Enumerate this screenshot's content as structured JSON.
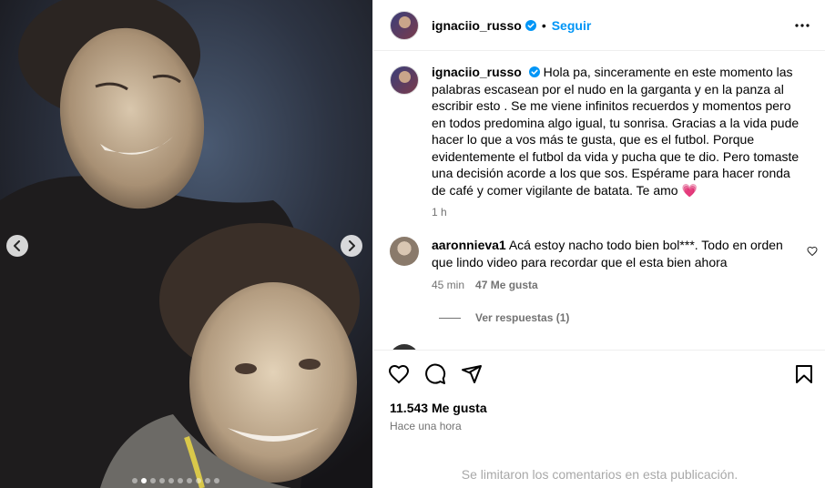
{
  "post": {
    "username": "ignaciio_russo",
    "separator": "•",
    "follow_label": "Seguir"
  },
  "caption": {
    "username": "ignaciio_russo",
    "text": "Hola pa, sinceramente en este momento las palabras escasean por el nudo en la garganta y en la panza al escribir esto . Se me viene infinitos recuerdos y momentos pero en todos predomina algo igual, tu sonrisa. Gracias a la vida pude hacer lo que a vos más te gusta, que es el futbol. Porque evidentemente el futbol da vida y pucha que te dio. Pero tomaste una decisión acorde a los que sos. Espérame para hacer ronda de café y comer vigilante de batata. Te amo",
    "emoji": "💗",
    "time": "1 h"
  },
  "comment": {
    "username": "aaronnieva1",
    "text": "Acá estoy nacho todo bien bol***. Todo en orden que lindo video para recordar que el esta bien ahora",
    "time": "45 min",
    "likes": "47 Me gusta"
  },
  "replies": {
    "label": "Ver respuestas (1)"
  },
  "engagement": {
    "likes": "11.543 Me gusta",
    "time": "Hace una hora",
    "comments_limited": "Se limitaron los comentarios en esta publicación."
  },
  "carousel": {
    "count": 10,
    "active_index": 1
  },
  "colors": {
    "link_blue": "#0095f6",
    "verified_blue": "#0095f6",
    "muted_text": "#737373",
    "divider": "#efefef"
  },
  "icons": {
    "more": "more-options-icon",
    "like": "heart-icon",
    "comment": "comment-icon",
    "share": "share-icon",
    "save": "bookmark-icon",
    "verified": "verified-badge-icon",
    "prev": "chevron-left-icon",
    "next": "chevron-right-icon"
  }
}
